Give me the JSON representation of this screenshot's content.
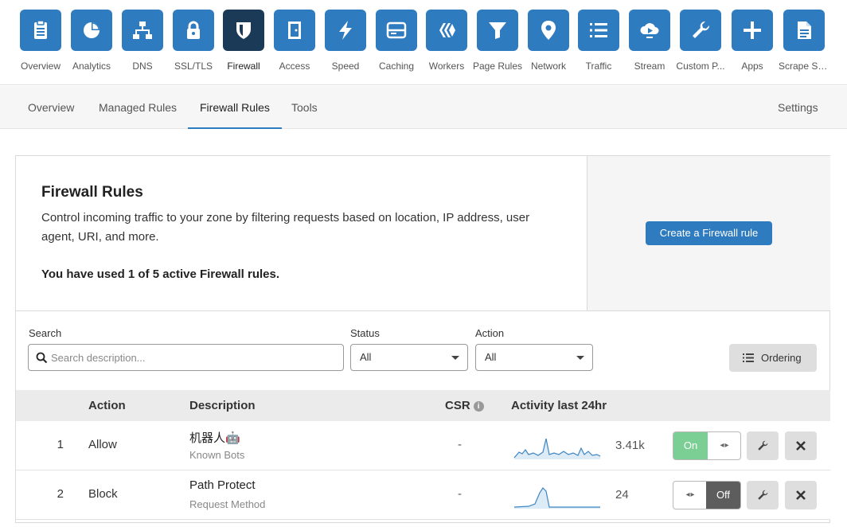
{
  "apps": [
    {
      "label": "Overview",
      "icon": "clipboard-icon"
    },
    {
      "label": "Analytics",
      "icon": "pie-chart-icon"
    },
    {
      "label": "DNS",
      "icon": "network-tree-icon"
    },
    {
      "label": "SSL/TLS",
      "icon": "lock-icon"
    },
    {
      "label": "Firewall",
      "icon": "shield-icon",
      "active": true
    },
    {
      "label": "Access",
      "icon": "door-icon"
    },
    {
      "label": "Speed",
      "icon": "lightning-icon"
    },
    {
      "label": "Caching",
      "icon": "server-icon"
    },
    {
      "label": "Workers",
      "icon": "workers-icon"
    },
    {
      "label": "Page Rules",
      "icon": "filter-icon"
    },
    {
      "label": "Network",
      "icon": "location-pin-icon"
    },
    {
      "label": "Traffic",
      "icon": "list-icon"
    },
    {
      "label": "Stream",
      "icon": "cloud-play-icon"
    },
    {
      "label": "Custom P...",
      "icon": "wrench-icon"
    },
    {
      "label": "Apps",
      "icon": "plus-icon"
    },
    {
      "label": "Scrape Sh...",
      "icon": "document-icon"
    }
  ],
  "subnav": {
    "tabs": [
      "Overview",
      "Managed Rules",
      "Firewall Rules",
      "Tools"
    ],
    "active": "Firewall Rules",
    "settings": "Settings"
  },
  "intro": {
    "title": "Firewall Rules",
    "description": "Control incoming traffic to your zone by filtering requests based on location, IP address, user agent, URI, and more.",
    "usage": "You have used 1 of 5 active Firewall rules.",
    "cta": "Create a Firewall rule"
  },
  "filters": {
    "search_label": "Search",
    "search_placeholder": "Search description...",
    "status_label": "Status",
    "status_value": "All",
    "action_label": "Action",
    "action_value": "All",
    "ordering": "Ordering"
  },
  "table": {
    "headers": {
      "action": "Action",
      "description": "Description",
      "csr": "CSR",
      "activity": "Activity last 24hr"
    },
    "rows": [
      {
        "num": "1",
        "action": "Allow",
        "name": "机器人🤖",
        "sub": "Known Bots",
        "csr": "-",
        "count": "3.41k",
        "toggle": "On"
      },
      {
        "num": "2",
        "action": "Block",
        "name": "Path Protect",
        "sub": "Request Method",
        "csr": "-",
        "count": "24",
        "toggle": "Off"
      }
    ]
  },
  "colors": {
    "brand": "#2f7bbf",
    "active_tile": "#1b3a57",
    "toggle_on": "#7bcf94",
    "toggle_off": "#5d5d5d"
  }
}
